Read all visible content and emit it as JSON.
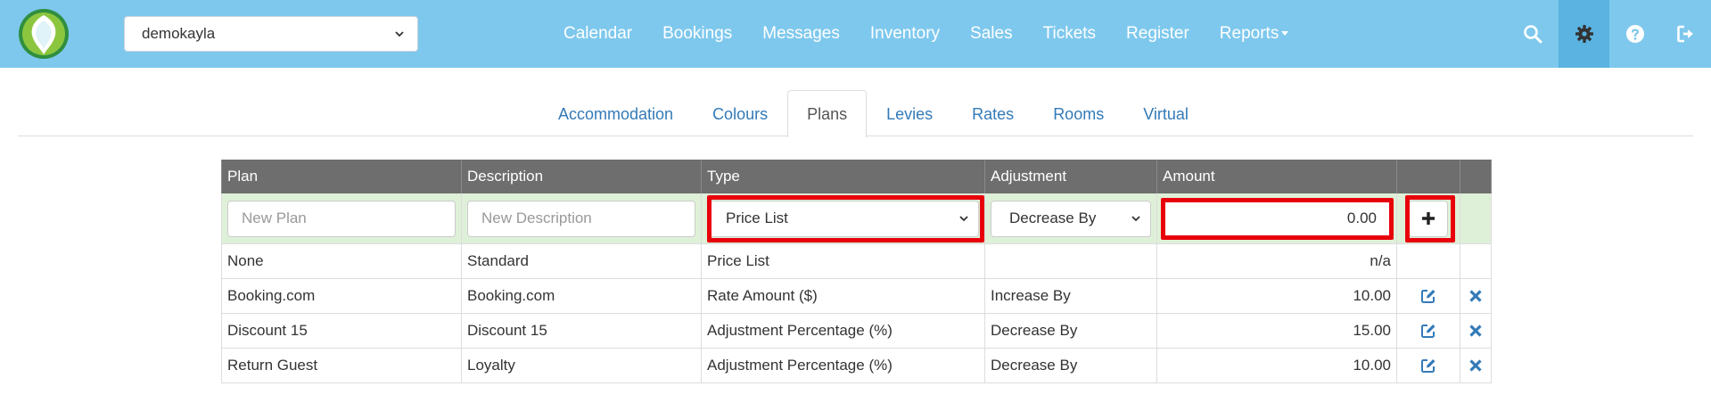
{
  "brand": {
    "logo_icon": "logo-icon",
    "colors": {
      "navbar": "#7ec8ed",
      "link": "#337ab7",
      "highlight": "#e8000b",
      "header": "#6e6e6e",
      "new_row": "#dff0d8"
    }
  },
  "property_select": {
    "value": "demokayla"
  },
  "nav": {
    "links": [
      "Calendar",
      "Bookings",
      "Messages",
      "Inventory",
      "Sales",
      "Tickets",
      "Register",
      "Reports"
    ],
    "icons": [
      "search-icon",
      "gear-icon",
      "help-icon",
      "logout-icon"
    ]
  },
  "tabs": [
    "Accommodation",
    "Colours",
    "Plans",
    "Levies",
    "Rates",
    "Rooms",
    "Virtual"
  ],
  "active_tab": "Plans",
  "table": {
    "headers": [
      "Plan",
      "Description",
      "Type",
      "Adjustment",
      "Amount",
      "",
      ""
    ],
    "new_row": {
      "plan_placeholder": "New Plan",
      "description_placeholder": "New Description",
      "type_value": "Price List",
      "adjustment_value": "Decrease By",
      "amount_value": "0.00",
      "add_icon": "plus-icon"
    },
    "rows": [
      {
        "plan": "None",
        "description": "Standard",
        "type": "Price List",
        "adjustment": "",
        "amount": "n/a"
      },
      {
        "plan": "Booking.com",
        "description": "Booking.com",
        "type": "Rate Amount ($)",
        "adjustment": "Increase By",
        "amount": "10.00"
      },
      {
        "plan": "Discount 15",
        "description": "Discount 15",
        "type": "Adjustment Percentage (%)",
        "adjustment": "Decrease By",
        "amount": "15.00"
      },
      {
        "plan": "Return Guest",
        "description": "Loyalty",
        "type": "Adjustment Percentage (%)",
        "adjustment": "Decrease By",
        "amount": "10.00"
      }
    ],
    "row_icons": [
      "edit-icon",
      "delete-icon"
    ]
  }
}
